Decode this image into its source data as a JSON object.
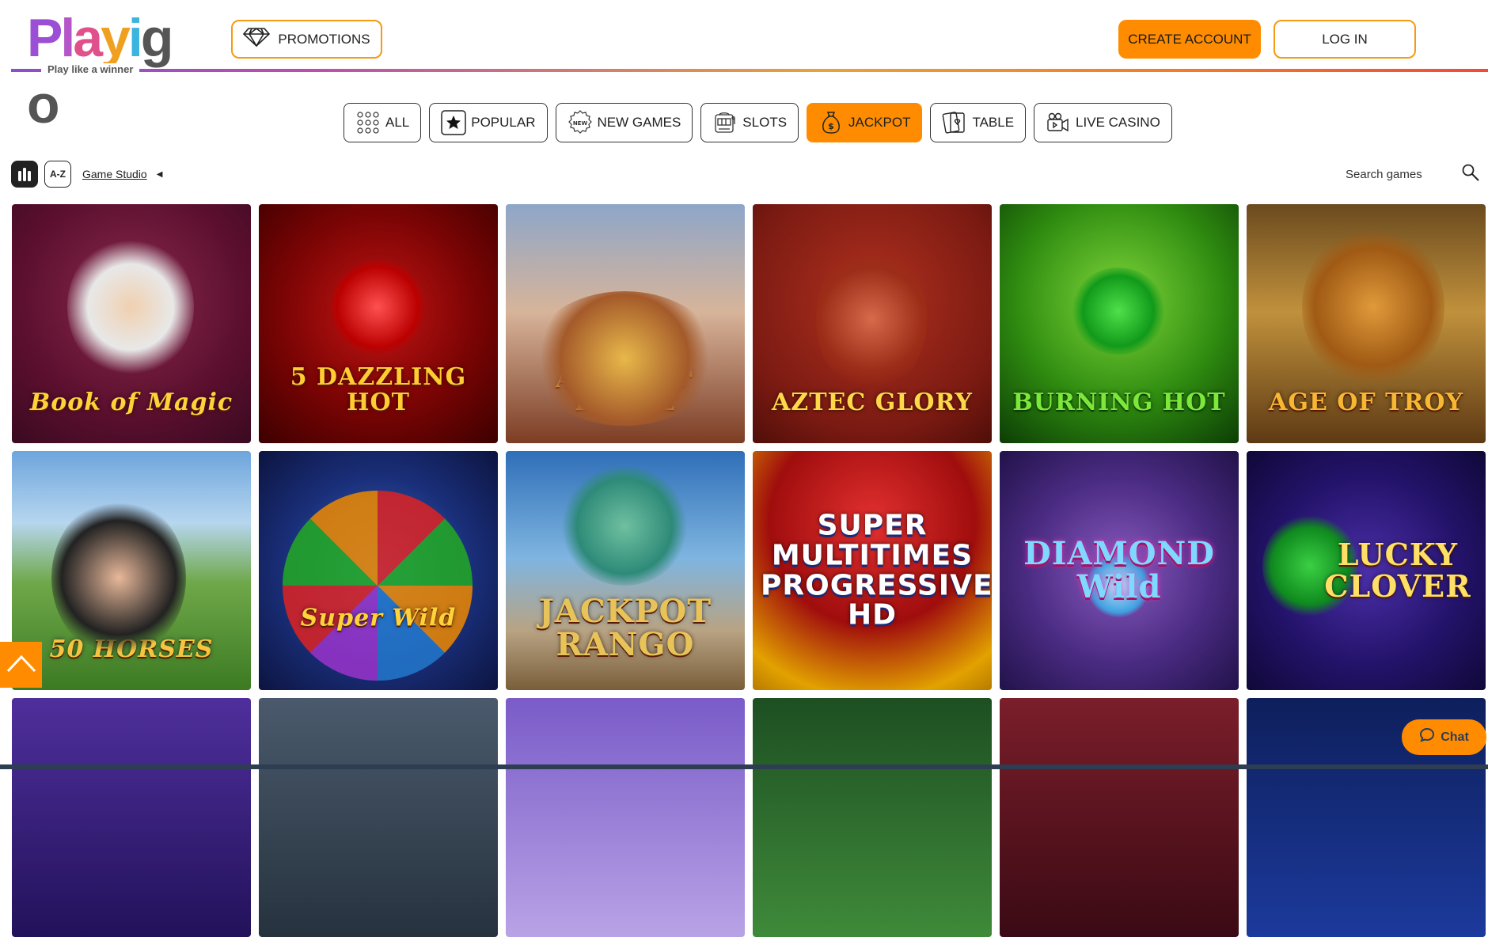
{
  "brand": {
    "logo_text": "Playigo",
    "tagline": "Play like a winner",
    "accent": "#ff8c00"
  },
  "header": {
    "promotions_label": "PROMOTIONS",
    "create_account_label": "CREATE ACCOUNT",
    "login_label": "LOG IN"
  },
  "categories": [
    {
      "label": "ALL",
      "icon": "dots-grid-icon",
      "active": false
    },
    {
      "label": "POPULAR",
      "icon": "star-icon",
      "active": false
    },
    {
      "label": "NEW GAMES",
      "icon": "new-badge-icon",
      "active": false
    },
    {
      "label": "SLOTS",
      "icon": "slot-machine-icon",
      "active": false
    },
    {
      "label": "JACKPOT",
      "icon": "money-bag-icon",
      "active": true
    },
    {
      "label": "TABLE",
      "icon": "cards-icon",
      "active": false
    },
    {
      "label": "LIVE CASINO",
      "icon": "video-camera-icon",
      "active": false
    }
  ],
  "filters": {
    "az_label": "A-Z",
    "studio_label": "Game Studio"
  },
  "search": {
    "placeholder": "Search games"
  },
  "games": [
    {
      "title": "Book of Magic",
      "color": "#ffd23a"
    },
    {
      "title": "5 DAZZLING HOT",
      "color": "#ffcc33"
    },
    {
      "title": "AMAZONS' BATTLE",
      "color": "#f0c050"
    },
    {
      "title": "AZTEC GLORY",
      "color": "#ffd84a"
    },
    {
      "title": "BURNING HOT",
      "color": "#7be83a"
    },
    {
      "title": "AGE OF TROY",
      "color": "#f7b733"
    },
    {
      "title": "50 HORSES",
      "color": "#f5c542"
    },
    {
      "title": "Super Wild",
      "color": "#ffd23a"
    },
    {
      "title": "JACKPOT RANGO",
      "color": "#e8c35a"
    },
    {
      "title": "SUPER MULTITIMES PROGRESSIVE HD",
      "color": "#ffffff"
    },
    {
      "title": "DIAMOND Wild",
      "color": "#7fd8ff"
    },
    {
      "title": "LUCKY CLOVER",
      "color": "#ffe066"
    },
    {
      "title": "",
      "color": "#ffffff"
    },
    {
      "title": "",
      "color": "#ffffff"
    },
    {
      "title": "",
      "color": "#ffffff"
    },
    {
      "title": "",
      "color": "#ffffff"
    },
    {
      "title": "",
      "color": "#ffffff"
    },
    {
      "title": "",
      "color": "#ffffff"
    }
  ],
  "chat": {
    "label": "Chat"
  }
}
